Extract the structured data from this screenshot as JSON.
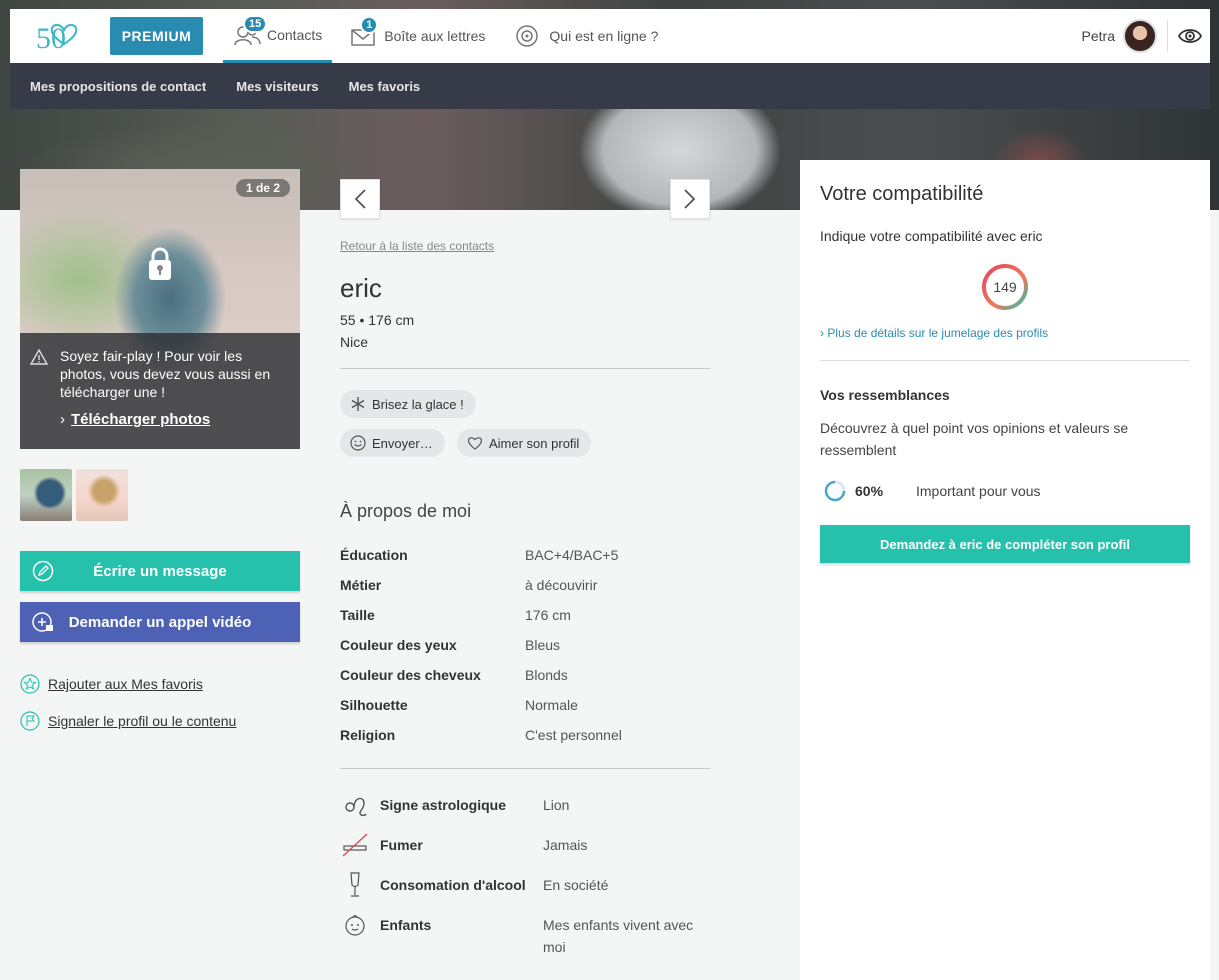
{
  "colors": {
    "accent": "#2a8bb0",
    "teal": "#26c1ac",
    "video": "#4e62b5",
    "subnav_bg": "#373b47"
  },
  "logo": {
    "text": "50"
  },
  "nav": {
    "premium": "PREMIUM",
    "contacts": {
      "label": "Contacts",
      "badge": "15"
    },
    "mailbox": {
      "label": "Boîte aux lettres",
      "badge": "1"
    },
    "online": {
      "label": "Qui est en ligne ?"
    },
    "user": {
      "name": "Petra"
    }
  },
  "subnav": {
    "items": [
      "Mes propositions de contact",
      "Mes visiteurs",
      "Mes favoris"
    ]
  },
  "photo": {
    "counter": "1 de 2",
    "notice": "Soyez fair-play ! Pour voir les photos, vous devez vous aussi en télécharger une !",
    "upload_link": "Télécharger photos"
  },
  "actions": {
    "write": "Écrire un message",
    "video": "Demander un appel vidéo",
    "favorite": "Rajouter aux Mes favoris",
    "report": "Signaler le profil ou le contenu"
  },
  "profile": {
    "back_link": "Retour à la liste des contacts",
    "name": "eric",
    "meta": "55 • 176 cm",
    "city": "Nice",
    "chips": {
      "icebreaker": "Brisez la glace !",
      "send": "Envoyer…",
      "like": "Aimer son profil"
    },
    "about_title": "À propos de moi",
    "details": [
      {
        "label": "Éducation",
        "value": "BAC+4/BAC+5"
      },
      {
        "label": "Métier",
        "value": "à découvirir"
      },
      {
        "label": "Taille",
        "value": "176 cm"
      },
      {
        "label": "Couleur des yeux",
        "value": "Bleus"
      },
      {
        "label": "Couleur des cheveux",
        "value": "Blonds"
      },
      {
        "label": "Silhouette",
        "value": "Normale"
      },
      {
        "label": "Religion",
        "value": "C'est personnel"
      }
    ],
    "lifestyle": [
      {
        "icon": "leo-icon",
        "label": "Signe astrologique",
        "value": "Lion"
      },
      {
        "icon": "no-smoking-icon",
        "label": "Fumer",
        "value": "Jamais"
      },
      {
        "icon": "champagne-icon",
        "label": "Consomation d'alcool",
        "value": "En société"
      },
      {
        "icon": "child-icon",
        "label": "Enfants",
        "value": "Mes enfants vivent avec moi"
      }
    ]
  },
  "compat": {
    "title": "Votre compatibilité",
    "subtitle": "Indique votre compatibilité avec eric",
    "score": "149",
    "details_link": "Plus de détails sur le jumelage des profils",
    "res_title": "Vos ressemblances",
    "res_desc": "Découvrez à quel point vos opinions et valeurs se ressemblent",
    "pct": "60%",
    "pct_label": "Important pour vous",
    "ask_button": "Demandez à eric de compléter son profil"
  }
}
